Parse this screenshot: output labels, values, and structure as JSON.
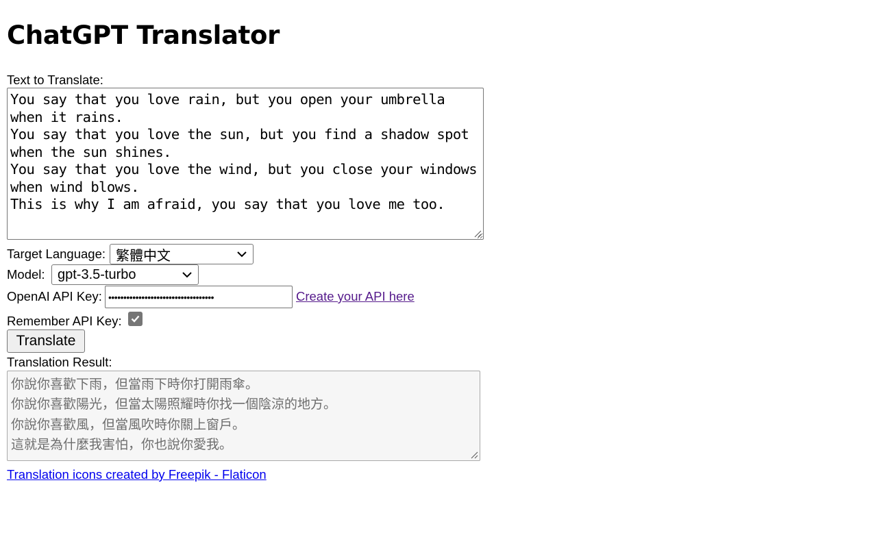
{
  "page": {
    "title": "ChatGPT Translator"
  },
  "source": {
    "label": "Text to Translate:",
    "value": "You say that you love rain, but you open your umbrella when it rains.\nYou say that you love the sun, but you find a shadow spot when the sun shines.\nYou say that you love the wind, but you close your windows when wind blows.\nThis is why I am afraid, you say that you love me too."
  },
  "target_language": {
    "label": "Target Language:",
    "selected": "繁體中文"
  },
  "model": {
    "label": "Model:",
    "selected": "gpt-3.5-turbo"
  },
  "api_key": {
    "label": "OpenAI API Key:",
    "masked_value": "•••••••••••••••••••••••••••••••••••",
    "create_link": "Create your API here"
  },
  "remember": {
    "label": "Remember API Key:",
    "checked": true
  },
  "actions": {
    "translate_label": "Translate"
  },
  "result": {
    "label": "Translation Result:",
    "value": "你說你喜歡下雨，但當雨下時你打開雨傘。\n你說你喜歡陽光，但當太陽照耀時你找一個陰涼的地方。\n你說你喜歡風，但當風吹時你關上窗戶。\n這就是為什麼我害怕，你也說你愛我。"
  },
  "footer": {
    "credit_link": "Translation icons created by Freepik - Flaticon"
  },
  "icons": {
    "dropdown": "chevron-down-icon",
    "check": "checkmark-icon",
    "resize": "resize-grip-icon"
  },
  "colors": {
    "visited_link": "#551a8b",
    "link": "#0000ee",
    "checkbox_fill": "#767676",
    "readonly_bg": "#f6f6f6"
  }
}
